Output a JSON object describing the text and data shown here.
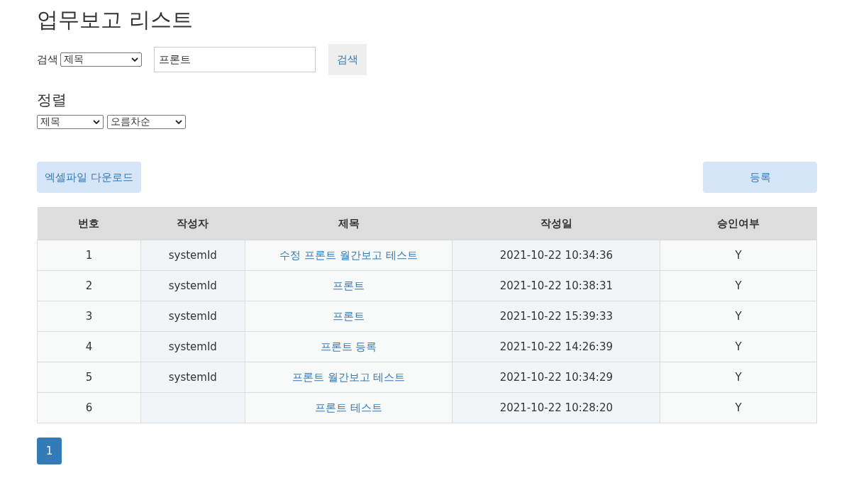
{
  "title": "업무보고 리스트",
  "search": {
    "label": "검색",
    "field_select": "제목",
    "query": "프론트",
    "button": "검색"
  },
  "sort": {
    "heading": "정렬",
    "field_select": "제목",
    "order_select": "오름차순"
  },
  "actions": {
    "excel_button": "엑셀파일 다운로드",
    "register_button": "등록"
  },
  "table": {
    "columns": [
      "번호",
      "작성자",
      "제목",
      "작성일",
      "승인여부"
    ],
    "rows": [
      {
        "no": "1",
        "author": "systemId",
        "title": "수정 프론트 월간보고 테스트",
        "date": "2021-10-22 10:34:36",
        "approved": "Y"
      },
      {
        "no": "2",
        "author": "systemId",
        "title": "프론트",
        "date": "2021-10-22 10:38:31",
        "approved": "Y"
      },
      {
        "no": "3",
        "author": "systemId",
        "title": "프론트",
        "date": "2021-10-22 15:39:33",
        "approved": "Y"
      },
      {
        "no": "4",
        "author": "systemId",
        "title": "프론트 등록",
        "date": "2021-10-22 14:26:39",
        "approved": "Y"
      },
      {
        "no": "5",
        "author": "systemId",
        "title": "프론트 월간보고 테스트",
        "date": "2021-10-22 10:34:29",
        "approved": "Y"
      },
      {
        "no": "6",
        "author": "",
        "title": "프론트 테스트",
        "date": "2021-10-22 10:28:20",
        "approved": "Y"
      }
    ]
  },
  "pagination": [
    {
      "label": "1",
      "selected": true
    }
  ]
}
